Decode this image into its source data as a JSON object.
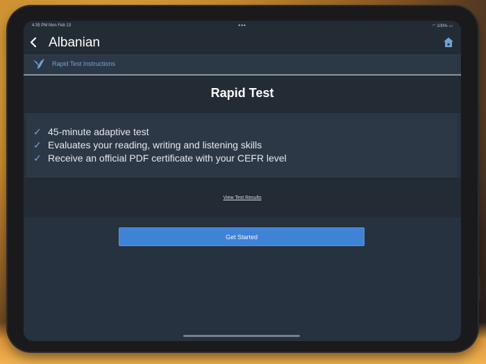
{
  "status": {
    "time": "4:35 PM  Mon Feb 13",
    "battery": "100%"
  },
  "nav": {
    "title": "Albanian",
    "back_icon": "chevron-left-icon",
    "home_icon": "home-icon"
  },
  "subheader": {
    "label": "Rapid Test Instructions",
    "icon": "bird-icon"
  },
  "page": {
    "title": "Rapid Test"
  },
  "features": [
    "45-minute adaptive test",
    "Evaluates your reading, writing and listening skills",
    "Receive an official PDF certificate with your CEFR level"
  ],
  "links": {
    "view_results": "View Test Results"
  },
  "buttons": {
    "get_started": "Get Started"
  },
  "colors": {
    "accent": "#3f83d6",
    "link": "#6fa3d8",
    "background": "#273240",
    "header": "#232b35"
  }
}
